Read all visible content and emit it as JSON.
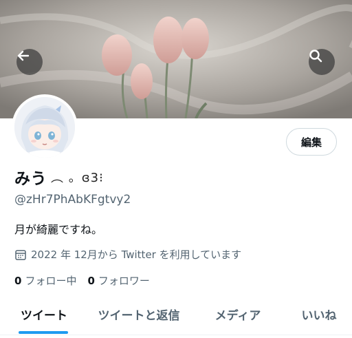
{
  "profile": {
    "display_name": "みう",
    "name_decoration": "︵ 。ɞ3⁝",
    "handle": "@zHr7PhAbKFgtvy2",
    "bio": "月が綺麗ですね。",
    "joined": "2022 年 12月から Twitter を利用しています",
    "following_count": "0",
    "following_label": "フォロー中",
    "followers_count": "0",
    "followers_label": "フォロワー"
  },
  "actions": {
    "edit_label": "編集"
  },
  "tabs": [
    {
      "label": "ツイート",
      "active": true
    },
    {
      "label": "ツイートと返信",
      "active": false
    },
    {
      "label": "メディア",
      "active": false
    },
    {
      "label": "いいね",
      "active": false
    }
  ],
  "icons": {
    "back": "arrow-left-icon",
    "search": "search-icon",
    "calendar": "calendar-icon"
  },
  "colors": {
    "accent": "#1d9bf0",
    "secondary_text": "#536471",
    "primary_text": "#0f1419"
  }
}
